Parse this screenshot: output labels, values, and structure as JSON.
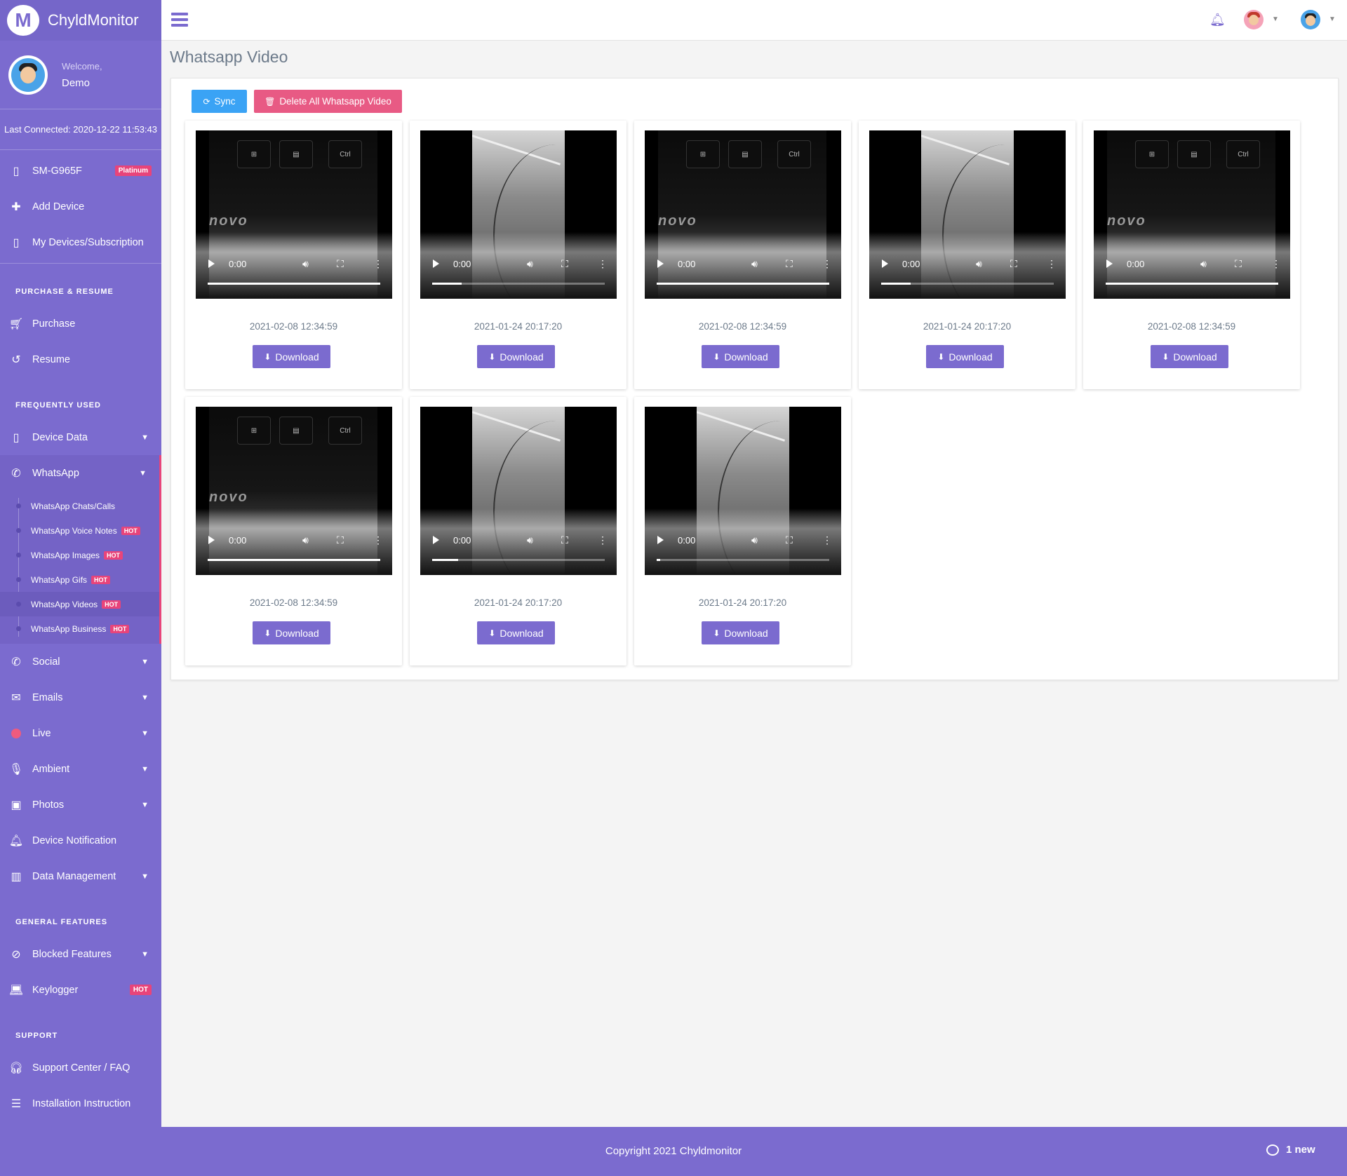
{
  "brand": {
    "name": "ChyldMonitor",
    "logo_letter": "M"
  },
  "user": {
    "welcome": "Welcome,",
    "name": "Demo",
    "last_connected": "Last Connected: 2020-12-22 11:53:43"
  },
  "devices": [
    {
      "label": "SM-G965F",
      "badge": "Platinum"
    },
    {
      "label": "Add Device"
    },
    {
      "label": "My Devices/Subscription"
    }
  ],
  "sections": {
    "purchase": "PURCHASE & RESUME",
    "frequent": "FREQUENTLY USED",
    "general": "GENERAL FEATURES",
    "support": "SUPPORT"
  },
  "purchase_items": [
    {
      "label": "Purchase"
    },
    {
      "label": "Resume"
    }
  ],
  "frequent_items": {
    "device_data": "Device Data",
    "whatsapp": "WhatsApp",
    "whatsapp_sub": [
      {
        "label": "WhatsApp Chats/Calls",
        "badge": ""
      },
      {
        "label": "WhatsApp Voice Notes",
        "badge": "HOT"
      },
      {
        "label": "WhatsApp Images",
        "badge": "HOT"
      },
      {
        "label": "WhatsApp Gifs",
        "badge": "HOT"
      },
      {
        "label": "WhatsApp Videos",
        "badge": "HOT"
      },
      {
        "label": "WhatsApp Business",
        "badge": "HOT"
      }
    ],
    "social": "Social",
    "emails": "Emails",
    "live": "Live",
    "ambient": "Ambient",
    "photos": "Photos",
    "device_notification": "Device Notification",
    "data_management": "Data Management"
  },
  "general_items": {
    "blocked": "Blocked Features",
    "keylogger": "Keylogger",
    "keylogger_badge": "HOT"
  },
  "support_items": {
    "faq": "Support Center / FAQ",
    "install": "Installation Instruction"
  },
  "page": {
    "title": "Whatsapp Video"
  },
  "toolbar": {
    "sync": "Sync",
    "delete_all": "Delete All Whatsapp Video"
  },
  "videos": [
    {
      "thumb": "keyboard",
      "time": "0:00",
      "progress": 1.0,
      "date": "2021-02-08 12:34:59",
      "download": "Download"
    },
    {
      "thumb": "fog",
      "time": "0:00",
      "progress": 0.17,
      "date": "2021-01-24 20:17:20",
      "download": "Download"
    },
    {
      "thumb": "keyboard",
      "time": "0:00",
      "progress": 1.0,
      "date": "2021-02-08 12:34:59",
      "download": "Download"
    },
    {
      "thumb": "fog",
      "time": "0:00",
      "progress": 0.17,
      "date": "2021-01-24 20:17:20",
      "download": "Download"
    },
    {
      "thumb": "keyboard",
      "time": "0:00",
      "progress": 1.0,
      "date": "2021-02-08 12:34:59",
      "download": "Download"
    },
    {
      "thumb": "keyboard",
      "time": "0:00",
      "progress": 1.0,
      "date": "2021-02-08 12:34:59",
      "download": "Download"
    },
    {
      "thumb": "fog",
      "time": "0:00",
      "progress": 0.15,
      "date": "2021-01-24 20:17:20",
      "download": "Download"
    },
    {
      "thumb": "fog",
      "time": "0:00",
      "progress": 0.02,
      "date": "2021-01-24 20:17:20",
      "download": "Download"
    }
  ],
  "keyboard_keys": [
    "⊞",
    "▤",
    "Ctrl"
  ],
  "keyboard_brand": "novo",
  "footer": {
    "copyright": "Copyright 2021 Chyldmonitor",
    "chat": "1 new"
  },
  "colors": {
    "accent": "#7b6bcf",
    "hot": "#e8447a",
    "sync": "#3aa3f5",
    "delete": "#e85a84"
  }
}
